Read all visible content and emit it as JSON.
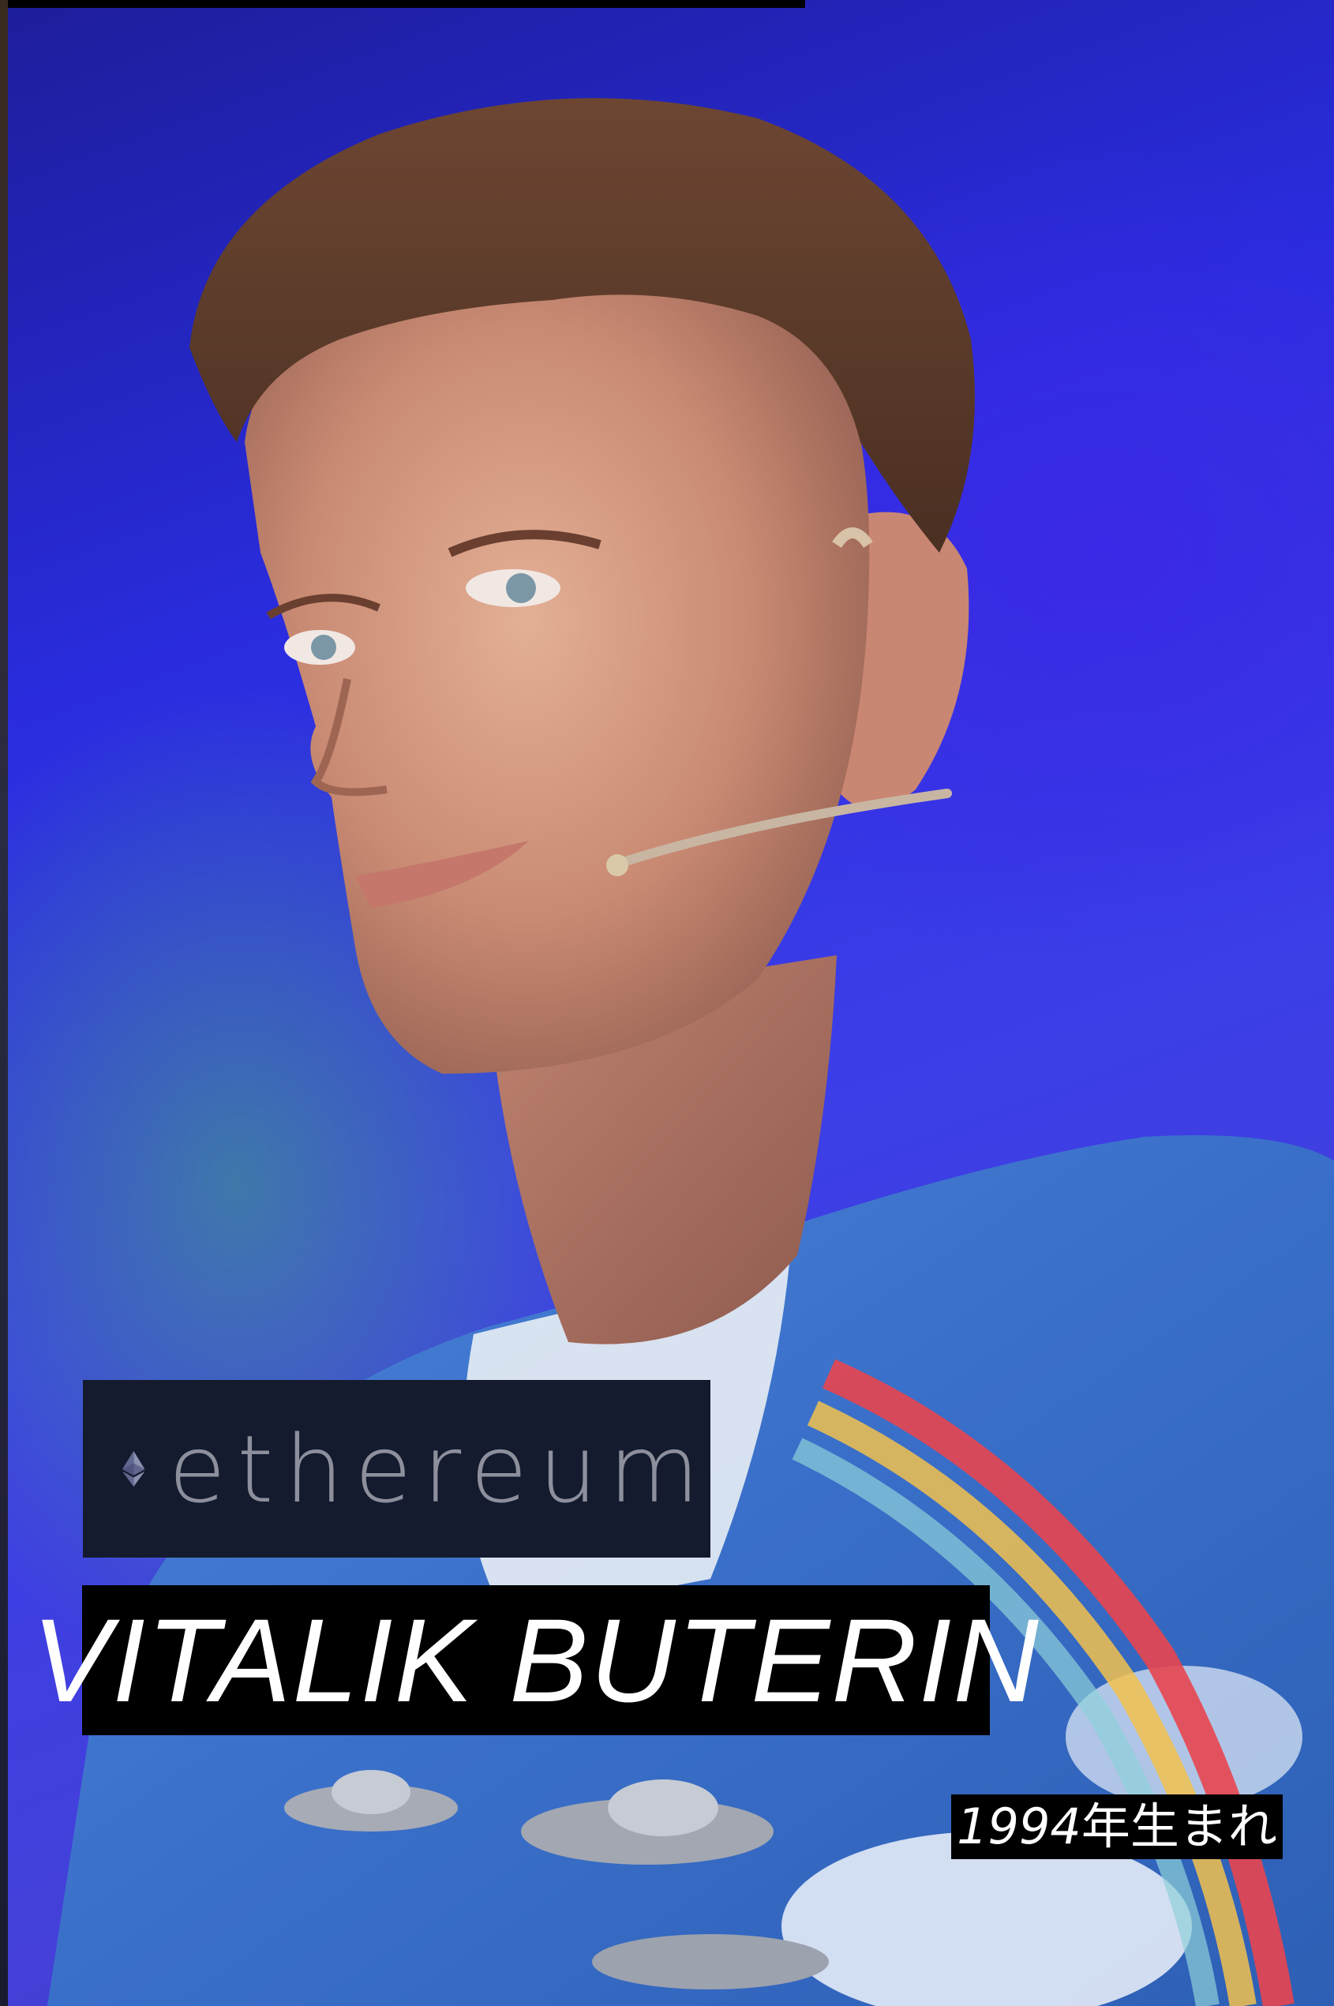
{
  "logo": {
    "text": "ethereum",
    "icon": "ethereum-diamond-icon",
    "box_color": "#141b2e",
    "text_color": "#8d8f9c"
  },
  "name": {
    "text": "VITALIK BUTERIN"
  },
  "birth": {
    "year": "1994",
    "suffix": "年生まれ"
  },
  "colors": {
    "background_blue": "#2a2de0",
    "background_green": "#46aa78",
    "shirt_blue": "#3a6fc9",
    "rainbow_red": "#e8454f"
  }
}
